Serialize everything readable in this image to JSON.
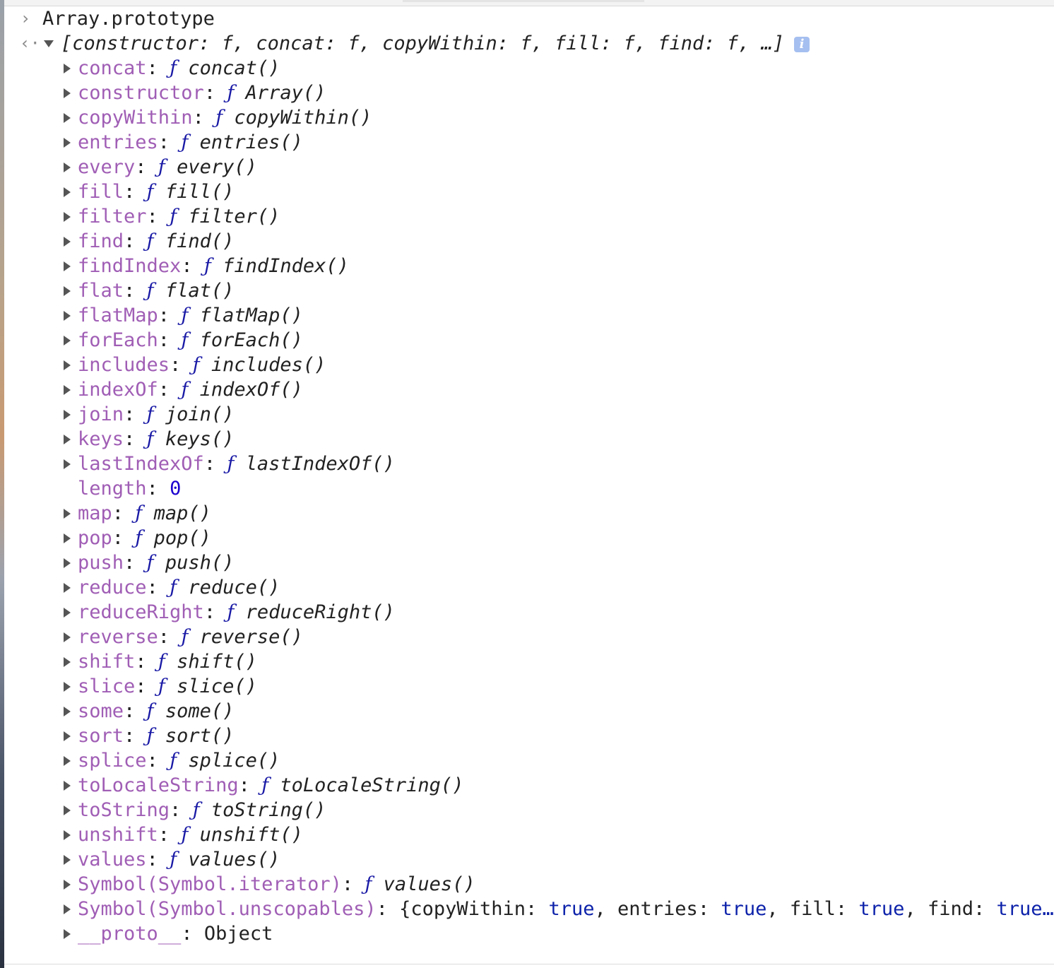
{
  "input": {
    "prompt_icon": "chevron-right-icon",
    "expression": "Array.prototype"
  },
  "result": {
    "return_icon": "arrow-left-icon",
    "summary": "[constructor: f, concat: f, copyWithin: f, fill: f, find: f, …]",
    "info_icon": "i",
    "properties": [
      {
        "key": "concat",
        "type": "function",
        "f": "ƒ",
        "name": "concat()"
      },
      {
        "key": "constructor",
        "type": "function",
        "f": "ƒ",
        "name": "Array()"
      },
      {
        "key": "copyWithin",
        "type": "function",
        "f": "ƒ",
        "name": "copyWithin()"
      },
      {
        "key": "entries",
        "type": "function",
        "f": "ƒ",
        "name": "entries()"
      },
      {
        "key": "every",
        "type": "function",
        "f": "ƒ",
        "name": "every()"
      },
      {
        "key": "fill",
        "type": "function",
        "f": "ƒ",
        "name": "fill()"
      },
      {
        "key": "filter",
        "type": "function",
        "f": "ƒ",
        "name": "filter()"
      },
      {
        "key": "find",
        "type": "function",
        "f": "ƒ",
        "name": "find()"
      },
      {
        "key": "findIndex",
        "type": "function",
        "f": "ƒ",
        "name": "findIndex()"
      },
      {
        "key": "flat",
        "type": "function",
        "f": "ƒ",
        "name": "flat()"
      },
      {
        "key": "flatMap",
        "type": "function",
        "f": "ƒ",
        "name": "flatMap()"
      },
      {
        "key": "forEach",
        "type": "function",
        "f": "ƒ",
        "name": "forEach()"
      },
      {
        "key": "includes",
        "type": "function",
        "f": "ƒ",
        "name": "includes()"
      },
      {
        "key": "indexOf",
        "type": "function",
        "f": "ƒ",
        "name": "indexOf()"
      },
      {
        "key": "join",
        "type": "function",
        "f": "ƒ",
        "name": "join()"
      },
      {
        "key": "keys",
        "type": "function",
        "f": "ƒ",
        "name": "keys()"
      },
      {
        "key": "lastIndexOf",
        "type": "function",
        "f": "ƒ",
        "name": "lastIndexOf()"
      },
      {
        "key": "length",
        "type": "number",
        "value": "0"
      },
      {
        "key": "map",
        "type": "function",
        "f": "ƒ",
        "name": "map()"
      },
      {
        "key": "pop",
        "type": "function",
        "f": "ƒ",
        "name": "pop()"
      },
      {
        "key": "push",
        "type": "function",
        "f": "ƒ",
        "name": "push()"
      },
      {
        "key": "reduce",
        "type": "function",
        "f": "ƒ",
        "name": "reduce()"
      },
      {
        "key": "reduceRight",
        "type": "function",
        "f": "ƒ",
        "name": "reduceRight()"
      },
      {
        "key": "reverse",
        "type": "function",
        "f": "ƒ",
        "name": "reverse()"
      },
      {
        "key": "shift",
        "type": "function",
        "f": "ƒ",
        "name": "shift()"
      },
      {
        "key": "slice",
        "type": "function",
        "f": "ƒ",
        "name": "slice()"
      },
      {
        "key": "some",
        "type": "function",
        "f": "ƒ",
        "name": "some()"
      },
      {
        "key": "sort",
        "type": "function",
        "f": "ƒ",
        "name": "sort()"
      },
      {
        "key": "splice",
        "type": "function",
        "f": "ƒ",
        "name": "splice()"
      },
      {
        "key": "toLocaleString",
        "type": "function",
        "f": "ƒ",
        "name": "toLocaleString()"
      },
      {
        "key": "toString",
        "type": "function",
        "f": "ƒ",
        "name": "toString()"
      },
      {
        "key": "unshift",
        "type": "function",
        "f": "ƒ",
        "name": "unshift()"
      },
      {
        "key": "values",
        "type": "function",
        "f": "ƒ",
        "name": "values()"
      },
      {
        "key": "Symbol(Symbol.iterator)",
        "type": "function",
        "f": "ƒ",
        "name": "values()"
      },
      {
        "key": "Symbol(Symbol.unscopables)",
        "type": "object-preview",
        "parts": [
          {
            "t": "plain",
            "v": "{copyWithin: "
          },
          {
            "t": "kw",
            "v": "true"
          },
          {
            "t": "plain",
            "v": ", entries: "
          },
          {
            "t": "kw",
            "v": "true"
          },
          {
            "t": "plain",
            "v": ", fill: "
          },
          {
            "t": "kw",
            "v": "true"
          },
          {
            "t": "plain",
            "v": ", find: "
          },
          {
            "t": "kw",
            "v": "true…"
          }
        ]
      },
      {
        "key": "__proto__",
        "type": "object",
        "value": "Object"
      }
    ]
  },
  "colors": {
    "property_key": "#a05eb5",
    "function_symbol": "#1a1aa6",
    "number": "#1c00cf",
    "keyword": "#0d22aa",
    "info_badge": "#a5bff0"
  }
}
